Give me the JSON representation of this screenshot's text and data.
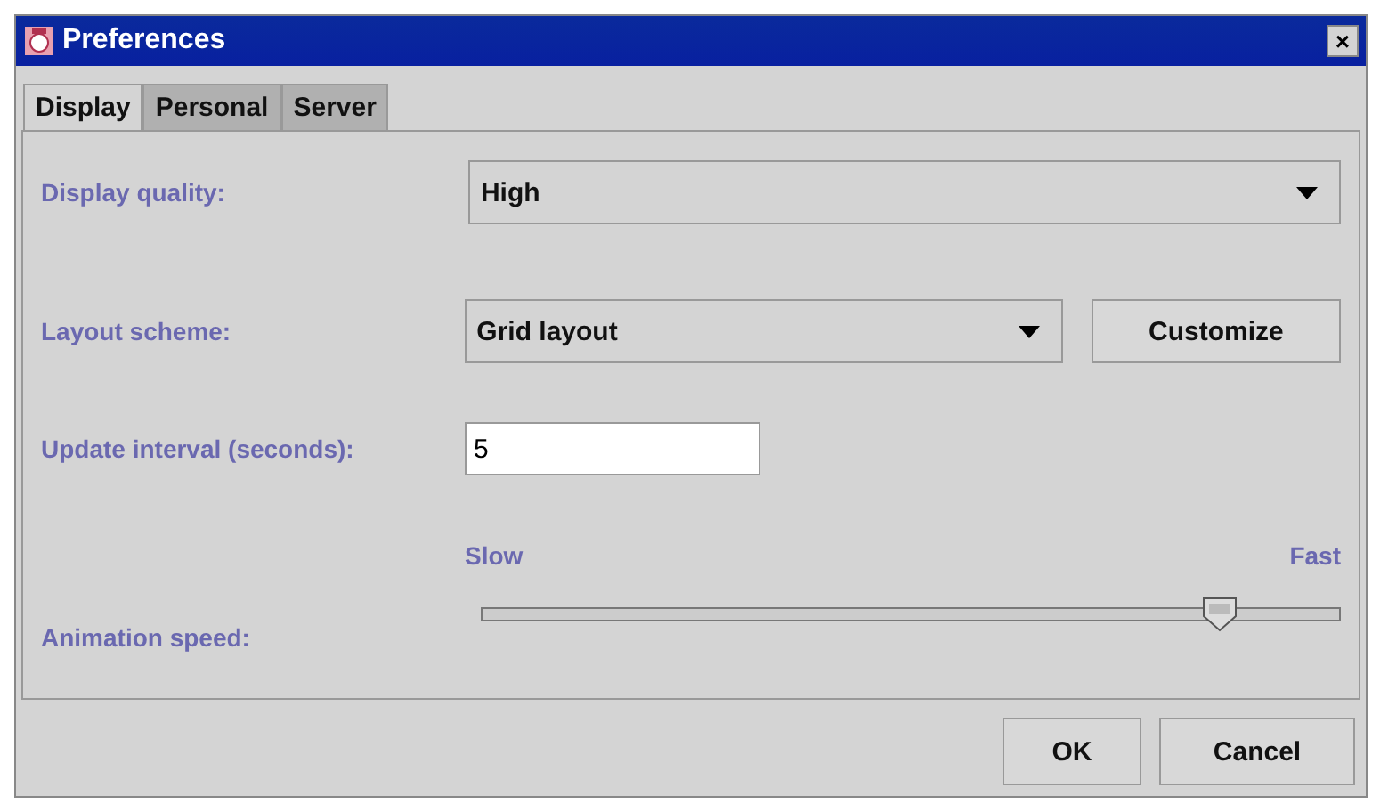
{
  "window": {
    "title": "Preferences",
    "close": "×"
  },
  "tabs": [
    {
      "label": "Display",
      "selected": true
    },
    {
      "label": "Personal",
      "selected": false
    },
    {
      "label": "Server",
      "selected": false
    }
  ],
  "display_quality": {
    "label": "Display quality:",
    "value": "High"
  },
  "layout_scheme": {
    "label": "Layout scheme:",
    "value": "Grid layout",
    "button": "Customize"
  },
  "update_interval": {
    "label": "Update interval (seconds):",
    "value": "5"
  },
  "animation_speed": {
    "label": "Animation speed:",
    "min_label": "Slow",
    "max_label": "Fast",
    "level": 0.86
  },
  "buttons": [
    "OK",
    "Cancel"
  ]
}
